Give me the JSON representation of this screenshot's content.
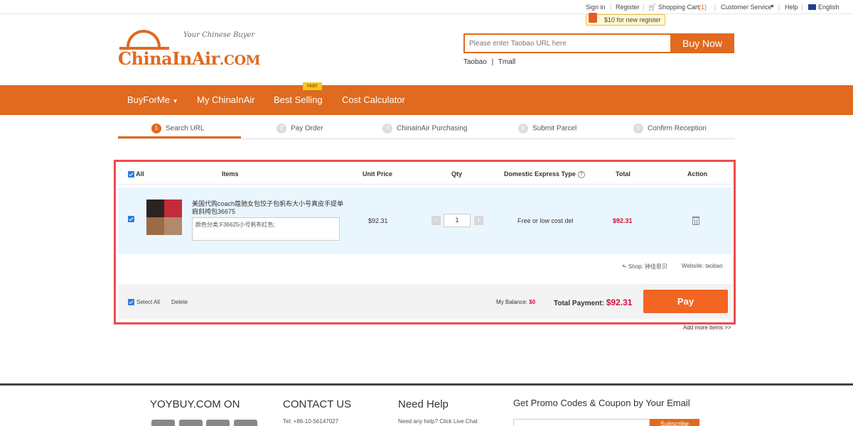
{
  "topbar": {
    "sign_in": "Sign in",
    "register": "Register",
    "cart": "Shopping Cart",
    "cart_count": "(1)",
    "customer_service": "Customer Service",
    "help": "Help",
    "language": "English",
    "promo": "$10 for new register"
  },
  "logo": {
    "tagline": "Your Chinese Buyer",
    "name_main": "ChinaInAir",
    "name_suffix": ".COM"
  },
  "search": {
    "placeholder": "Please enter Taobao URL here",
    "button": "Buy Now",
    "link_taobao": "Taobao",
    "link_sep": "|",
    "link_tmall": "Tmall"
  },
  "nav": {
    "items": [
      "BuyForMe",
      "My ChinaInAir",
      "Best Selling",
      "Cost Calculator"
    ],
    "hot_badge": "Hot!!"
  },
  "steps": [
    {
      "num": "1",
      "label": "Search URL"
    },
    {
      "num": "2",
      "label": "Pay Order"
    },
    {
      "num": "3",
      "label": "ChinaInAir Purchasing"
    },
    {
      "num": "4",
      "label": "Submit Parcel"
    },
    {
      "num": "5",
      "label": "Confirm Reception"
    }
  ],
  "cart": {
    "headers": {
      "all": "All",
      "items": "Items",
      "unit_price": "Unit Price",
      "qty": "Qty",
      "express": "Domestic Express Type",
      "total": "Total",
      "action": "Action"
    },
    "item": {
      "title": "美国代购coach蔻驰女包饺子包帆布大小号真皮手提单肩斜挎包36675",
      "spec": "颜色分类:F36625小号帆布红色;",
      "unit_price": "$92.31",
      "qty": "1",
      "qty_minus": "−",
      "qty_plus": "+",
      "express": "Free or low cost del",
      "total": "$92.31"
    },
    "shop": {
      "shop_label": "Shop: 钟佳思贝",
      "website": "Website: taobao"
    },
    "footer": {
      "select_all": "Select All",
      "delete": "Delete",
      "balance_label": "My Balance:",
      "balance_value": "$0",
      "total_label": "Total Payment:",
      "total_value": "$92.31",
      "pay": "Pay"
    },
    "add_more": "Add more items >>"
  },
  "footer": {
    "col1": "YOYBUY.COM ON",
    "col2": "CONTACT US",
    "col2_sub": "Tel: +86-10-56147027",
    "col3": "Need Help",
    "col3_sub": "Need any help? Click Live Chat",
    "col4": "Get Promo Codes & Coupon by Your Email",
    "subscribe": "Subscribe"
  },
  "colors": {
    "brand_orange": "#e06a1f",
    "pay_orange": "#f26522",
    "price_red": "#d0103a",
    "highlight_border": "#ef4b4b",
    "row_bg": "#eaf6fd"
  }
}
